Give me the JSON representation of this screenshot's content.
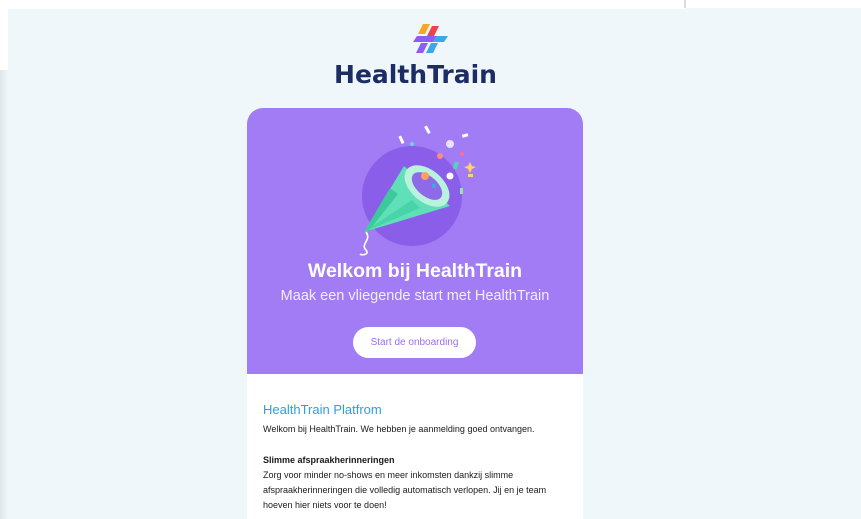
{
  "brand": {
    "name": "HealthTrain",
    "logo_colors": [
      "#f5a623",
      "#8b5cf6",
      "#3aa8e8",
      "#ef4444"
    ]
  },
  "colors": {
    "background": "#f0f7fb",
    "hero": "#a27cf4",
    "accent_blue": "#2b9fe0",
    "cta_text": "#9a6ff0"
  },
  "hero": {
    "title": "Welkom bij HealthTrain",
    "subtitle": "Maak een vliegende start met HealthTrain",
    "cta_label": "Start de onboarding",
    "illustration": "party-popper-icon"
  },
  "content": {
    "section_title": "HealthTrain Platfrom",
    "intro": "Welkom bij HealthTrain. We hebben je aanmelding goed ontvangen.",
    "feature_title": "Slimme afspraakherinneringen",
    "feature_lines": [
      "Zorg voor minder no-shows en meer inkomsten dankzij slimme",
      "afspraakherinneringen die volledig automatisch verlopen. Jij en je team",
      "hoeven hier niets voor te doen!"
    ]
  }
}
